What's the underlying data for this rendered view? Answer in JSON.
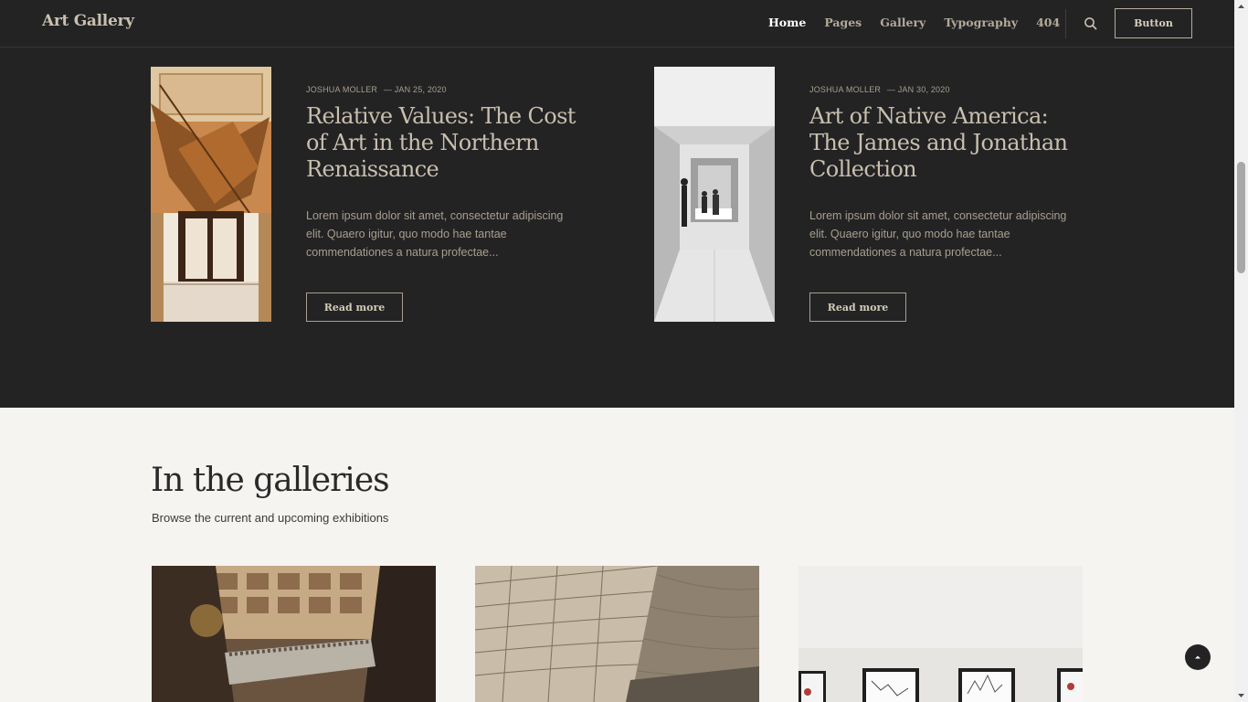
{
  "header": {
    "logo": "Art Gallery",
    "nav": [
      "Home",
      "Pages",
      "Gallery",
      "Typography",
      "404"
    ],
    "button_label": "Button",
    "search_icon": "search-icon"
  },
  "posts": [
    {
      "author": "JOSHUA MOLLER",
      "date": "— JAN 25, 2020",
      "title": "Relative Values: The Cost of Art in the Northern Renaissance",
      "excerpt": "Lorem ipsum dolor sit amet, consectetur adipiscing elit. Quaero igitur, quo modo hae tantae commendationes a natura profectae...",
      "read_more": "Read more"
    },
    {
      "author": "JOSHUA MOLLER",
      "date": "— JAN 30, 2020",
      "title": "Art of Native America: The James and Jonathan Collection",
      "excerpt": "Lorem ipsum dolor sit amet, consectetur adipiscing elit. Quaero igitur, quo modo hae tantae commendationes a natura profectae...",
      "read_more": "Read more"
    }
  ],
  "galleries": {
    "title": "In the galleries",
    "subtitle": "Browse the current and upcoming exhibitions"
  },
  "colors": {
    "dark_bg": "#232324",
    "light_bg": "#f5f4f1",
    "accent": "#c8bfae"
  }
}
